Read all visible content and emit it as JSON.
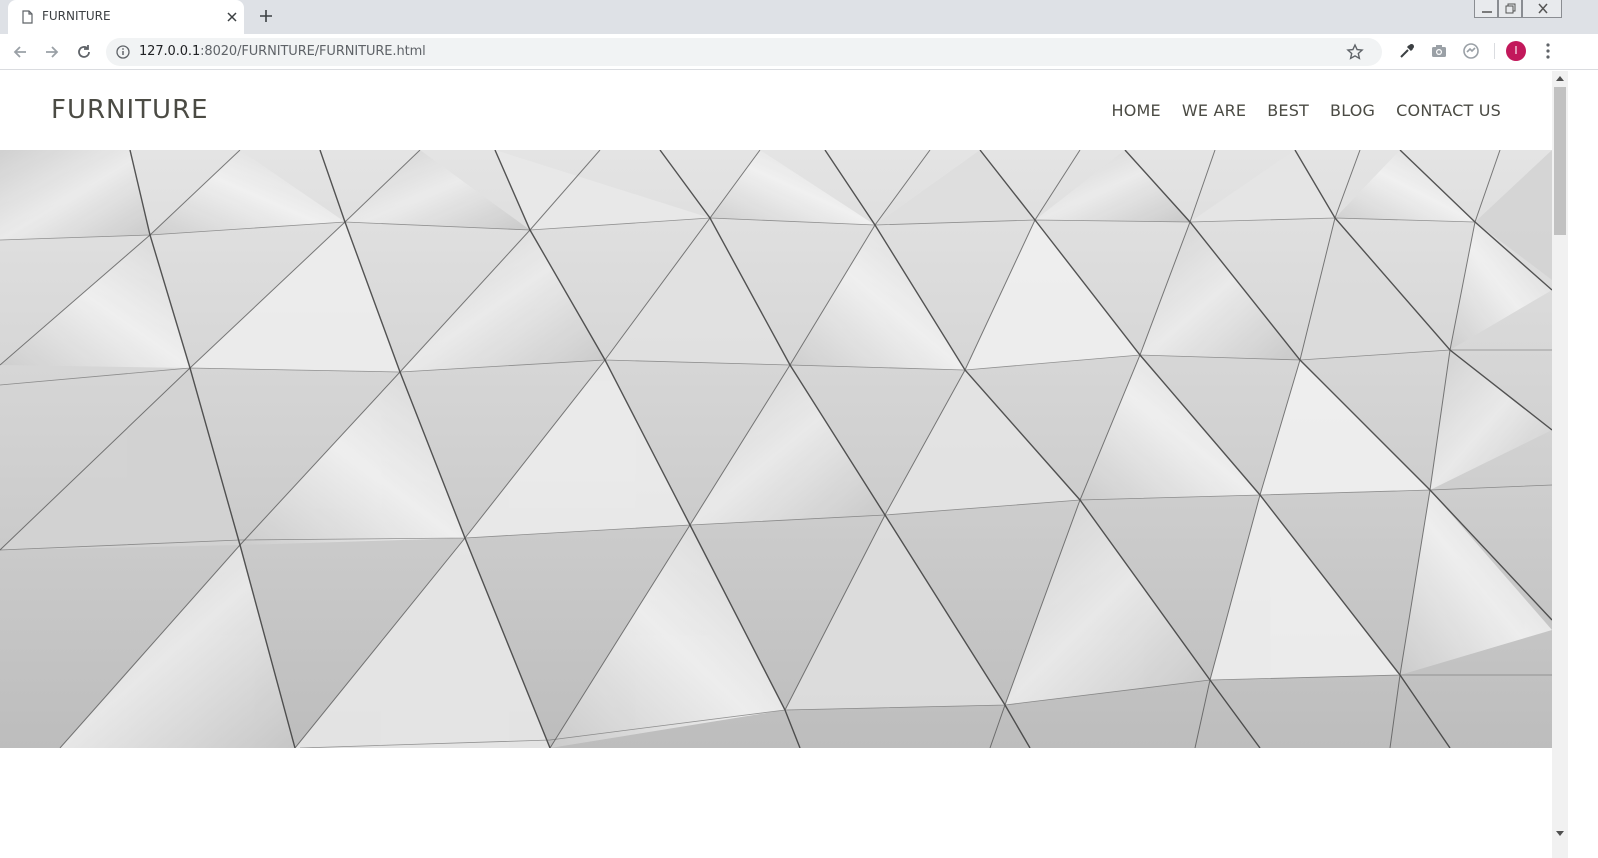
{
  "browser": {
    "tab_title": "FURNITURE",
    "url_host": "127.0.0.1",
    "url_path": ":8020/FURNITURE/FURNITURE.html",
    "profile_initial": "I",
    "profile_color": "#c2185b"
  },
  "site": {
    "brand": "FURNITURE",
    "nav": [
      {
        "label": "HOME"
      },
      {
        "label": "WE ARE"
      },
      {
        "label": "BEST"
      },
      {
        "label": "BLOG"
      },
      {
        "label": "CONTACT US"
      }
    ]
  },
  "colors": {
    "text": "#4b4b44",
    "hero_base": "#d9d9d9"
  }
}
